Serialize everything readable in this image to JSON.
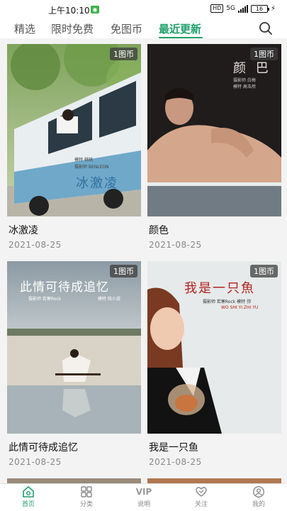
{
  "status": {
    "time": "上午10:10",
    "hd": "HD",
    "network": "5G",
    "battery": "16"
  },
  "tabs": [
    {
      "label": "精选"
    },
    {
      "label": "限时免费"
    },
    {
      "label": "免图币"
    },
    {
      "label": "最近更新"
    }
  ],
  "cards": [
    {
      "title": "冰激凌",
      "date": "2021-08-25",
      "badge": "1图币",
      "overlay": {
        "big": "冰激凌",
        "small1": "摄影师 BENLEON",
        "small2": "模特 桃桃"
      }
    },
    {
      "title": "颜色",
      "date": "2021-08-25",
      "badge": "1图币",
      "overlay": {
        "big": "颜 巴",
        "small1": "摄影师 白梅",
        "small2": "模特 高浩然"
      }
    },
    {
      "title": "此情可待成追忆",
      "date": "2021-08-25",
      "badge": "1图币",
      "overlay": {
        "big": "此情可待成追忆",
        "small1": "摄影师 若寒Rock",
        "small2": "模特 晓小游"
      }
    },
    {
      "title": "我是一只鱼",
      "date": "2021-08-25",
      "badge": "1图币",
      "overlay": {
        "big": "我是一只魚",
        "small1": "摄影师 若寒Rock 模特 弥",
        "small2": "WO SHI YI ZHI YU"
      }
    }
  ],
  "nav": [
    {
      "label": "首页",
      "icon": "home-icon",
      "active": true
    },
    {
      "label": "分类",
      "icon": "grid-icon"
    },
    {
      "label": "说明",
      "icon": "vip-icon",
      "text": "VIP"
    },
    {
      "label": "关注",
      "icon": "heart-icon"
    },
    {
      "label": "我的",
      "icon": "user-icon"
    }
  ],
  "colors": {
    "accent": "#1fa06a"
  }
}
